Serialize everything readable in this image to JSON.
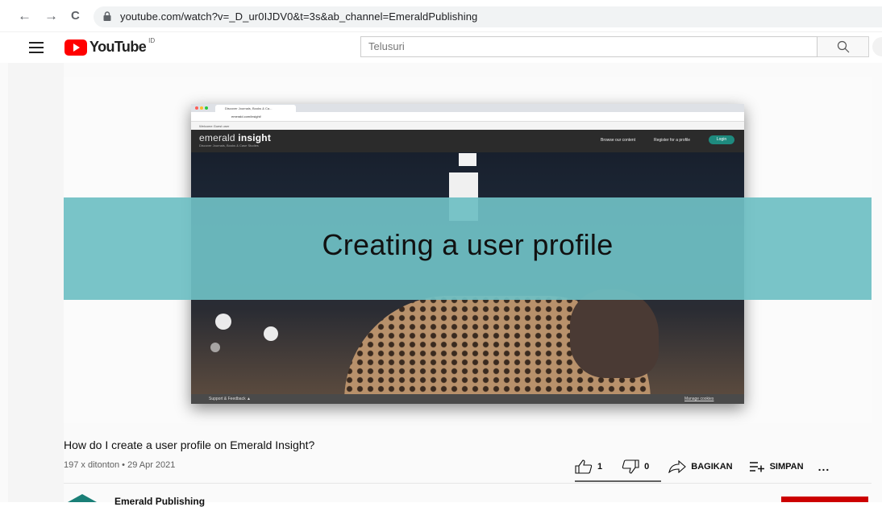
{
  "browser": {
    "back": "←",
    "forward": "→",
    "reload": "C",
    "url": "youtube.com/watch?v=_D_ur0IJDV0&t=3s&ab_channel=EmeraldPublishing"
  },
  "header": {
    "logo_text": "YouTube",
    "country_code": "ID",
    "search_placeholder": "Telusuri"
  },
  "video": {
    "banner_text": "Creating a user profile",
    "inner_screen": {
      "tab_label": "Discover Journals, Books & Ca...",
      "url": "emerald.com/insight/",
      "welcome": "Welcome Guest user",
      "brand_light": "emerald ",
      "brand_bold": "insight",
      "brand_sub": "Discover Journals, Books & Case Studies",
      "nav_browse": "Browse our content",
      "nav_register": "Register for a profile",
      "login": "Login",
      "footer_left": "Support & Feedback ▲",
      "footer_right": "Manage cookies"
    }
  },
  "details": {
    "title": "How do I create a user profile on Emerald Insight?",
    "meta": "197 x ditonton • 29 Apr 2021",
    "likes": "1",
    "dislikes": "0",
    "share": "BAGIKAN",
    "save": "SIMPAN",
    "more": "..."
  },
  "channel": {
    "name": "Emerald Publishing"
  },
  "colors": {
    "youtube_red": "#ff0000",
    "banner_teal": "#6fbfc4",
    "subscribe_red": "#cc0000"
  }
}
